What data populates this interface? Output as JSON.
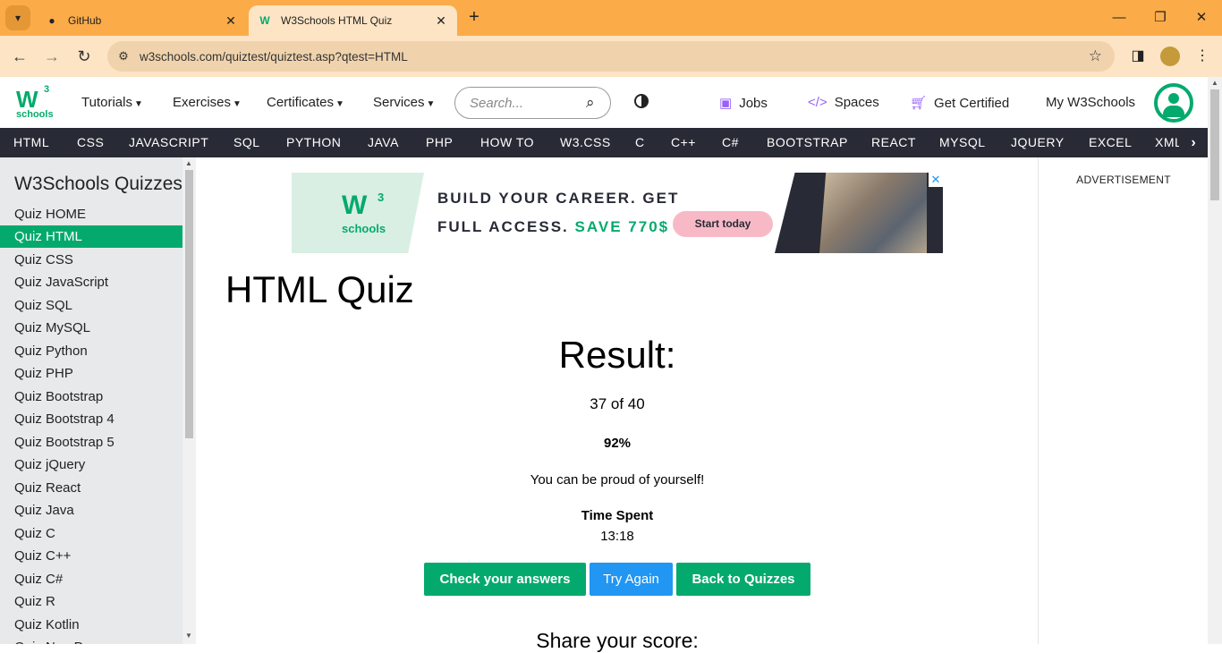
{
  "browser": {
    "tabs": [
      {
        "title": "GitHub",
        "icon": "github-icon"
      },
      {
        "title": "W3Schools HTML Quiz",
        "icon": "w3schools-favicon"
      }
    ],
    "url": "w3schools.com/quiztest/quiztest.asp?qtest=HTML"
  },
  "topnav": {
    "logo_w3": "W",
    "logo_sup": "3",
    "logo_text": "schools",
    "menus": [
      "Tutorials",
      "Exercises",
      "Certificates",
      "Services"
    ],
    "search_placeholder": "Search...",
    "jobs": "Jobs",
    "spaces": "Spaces",
    "get_certified": "Get Certified",
    "my_w3schools": "My W3Schools"
  },
  "subjects": [
    "HTML",
    "CSS",
    "JAVASCRIPT",
    "SQL",
    "PYTHON",
    "JAVA",
    "PHP",
    "HOW TO",
    "W3.CSS",
    "C",
    "C++",
    "C#",
    "BOOTSTRAP",
    "REACT",
    "MYSQL",
    "JQUERY",
    "EXCEL",
    "XML"
  ],
  "sidebar": {
    "title": "W3Schools Quizzes",
    "items": [
      "Quiz HOME",
      "Quiz HTML",
      "Quiz CSS",
      "Quiz JavaScript",
      "Quiz SQL",
      "Quiz MySQL",
      "Quiz Python",
      "Quiz PHP",
      "Quiz Bootstrap",
      "Quiz Bootstrap 4",
      "Quiz Bootstrap 5",
      "Quiz jQuery",
      "Quiz React",
      "Quiz Java",
      "Quiz C",
      "Quiz C++",
      "Quiz C#",
      "Quiz R",
      "Quiz Kotlin",
      "Quiz NumPy"
    ],
    "active_index": 1
  },
  "ad": {
    "logo": "W",
    "logo_sup": "3",
    "logo_text": "schools",
    "line1": "BUILD YOUR CAREER. GET",
    "line2_a": "FULL ACCESS.",
    "line2_b": "SAVE 770$",
    "cta": "Start today"
  },
  "main": {
    "title": "HTML Quiz",
    "result_heading": "Result:",
    "score": "37 of 40",
    "percent": "92%",
    "message": "You can be proud of yourself!",
    "time_label": "Time Spent",
    "time_value": "13:18",
    "buttons": {
      "check": "Check your answers",
      "try_again": "Try Again",
      "back": "Back to Quizzes"
    },
    "share_heading": "Share your score:"
  },
  "right": {
    "advertisement": "ADVERTISEMENT"
  },
  "colors": {
    "chrome_tabbar": "#fbab48",
    "w3_green": "#04aa6d",
    "w3_dark": "#282a35",
    "blue": "#2196f3"
  }
}
